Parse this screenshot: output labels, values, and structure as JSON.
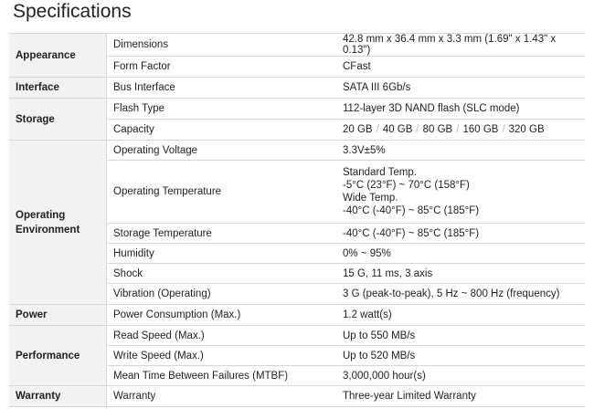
{
  "page_title": "Specifications",
  "sections": [
    {
      "category": "Appearance",
      "rows": [
        {
          "item": "Dimensions",
          "value": "42.8 mm x 36.4 mm x 3.3 mm (1.69\" x 1.43\" x 0.13\")"
        },
        {
          "item": "Form Factor",
          "value": "CFast"
        }
      ]
    },
    {
      "category": "Interface",
      "rows": [
        {
          "item": "Bus Interface",
          "value": "SATA III 6Gb/s"
        }
      ]
    },
    {
      "category": "Storage",
      "rows": [
        {
          "item": "Flash Type",
          "value": "112-layer 3D NAND flash (SLC mode)"
        },
        {
          "item": "Capacity",
          "capacities": [
            "20 GB",
            "40 GB",
            "80 GB",
            "160 GB",
            "320 GB"
          ]
        }
      ]
    },
    {
      "category_line1": "Operating",
      "category_line2": "Environment",
      "rows": [
        {
          "item": "Operating Voltage",
          "value": "3.3V±5%"
        },
        {
          "item": "Operating Temperature",
          "lines": [
            "Standard Temp.",
            "-5°C (23°F) ~ 70°C (158°F)",
            "Wide Temp.",
            "-40°C (-40°F) ~ 85°C (185°F)"
          ]
        },
        {
          "item": "Storage Temperature",
          "value": "-40°C (-40°F) ~ 85°C (185°F)"
        },
        {
          "item": "Humidity",
          "value": "0% ~ 95%"
        },
        {
          "item": "Shock",
          "value": "15 G, 11 ms, 3 axis"
        },
        {
          "item": "Vibration (Operating)",
          "value": "3 G (peak-to-peak), 5 Hz ~ 800 Hz (frequency)"
        }
      ]
    },
    {
      "category": "Power",
      "rows": [
        {
          "item": "Power Consumption (Max.)",
          "value": "1.2 watt(s)"
        }
      ]
    },
    {
      "category": "Performance",
      "rows": [
        {
          "item": "Read Speed (Max.)",
          "value": "Up to 550 MB/s"
        },
        {
          "item": "Write Speed (Max.)",
          "value": "Up to 520 MB/s"
        },
        {
          "item": "Mean Time Between Failures (MTBF)",
          "value": "3,000,000 hour(s)"
        }
      ]
    },
    {
      "category": "Warranty",
      "rows": [
        {
          "item": "Warranty",
          "value": "Three-year Limited Warranty"
        }
      ]
    }
  ],
  "separator": "/"
}
